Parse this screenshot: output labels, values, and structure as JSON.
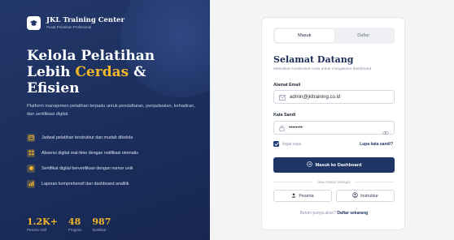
{
  "brand": {
    "name": "JKL Training Center",
    "subtitle": "Pusat Pelatihan Profesional"
  },
  "hero": {
    "line1": "Kelola Pelatihan",
    "line2_prefix": "Lebih ",
    "line2_accent": "Cerdas",
    "line2_suffix": " &",
    "line3": "Efisien",
    "description": "Platform manajemen pelatihan terpadu untuk pendaftaran, penjadwalan, kehadiran, dan sertifikasi digital."
  },
  "features": [
    {
      "icon": "calendar-icon",
      "text": "Jadwal pelatihan terstruktur dan mudah dikelola"
    },
    {
      "icon": "qr-icon",
      "text": "Absensi digital real-time dengan notifikasi otomatis"
    },
    {
      "icon": "certificate-icon",
      "text": "Sertifikat digital berverifikasi dengan nomor unik"
    },
    {
      "icon": "chart-icon",
      "text": "Laporan komprehensif dan dashboard analitik"
    }
  ],
  "stats": [
    {
      "value": "1.2K+",
      "label": "Peserta Aktif"
    },
    {
      "value": "48",
      "label": "Program"
    },
    {
      "value": "987",
      "label": "Sertifikat"
    }
  ],
  "login": {
    "tab_login": "Masuk",
    "tab_register": "Daftar",
    "title": "Selamat Datang",
    "subtitle": "Masukkan kredensial Anda untuk mengakses dashboard",
    "email_label": "Alamat Email",
    "email_value": "admin@jkltraining.co.id",
    "password_label": "Kata Sandi",
    "password_value": "••••••••",
    "remember_label": "Ingat saya",
    "remember_checked": true,
    "forgot_label": "Lupa kata sandi?",
    "submit_label": "Masuk ke Dashboard",
    "divider_text": "atau masuk sebagai",
    "role_participant": "Peserta",
    "role_instructor": "Instruktur",
    "signup_prompt": "Belum punya akun?",
    "signup_link": "Daftar sekarang"
  },
  "colors": {
    "navy": "#1f3566",
    "accent": "#f4b72a",
    "panel": "#1b2e5c"
  }
}
